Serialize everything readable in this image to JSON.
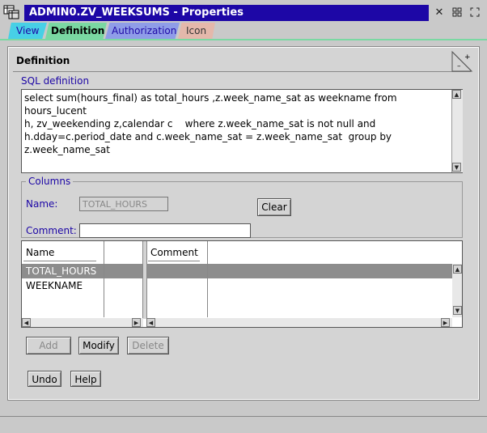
{
  "window": {
    "title": "ADMIN0.ZV_WEEKSUMS - Properties",
    "controls": {
      "close": "✕",
      "restore": "▫",
      "maximize": "⛶"
    }
  },
  "tabs": [
    {
      "label": "View"
    },
    {
      "label": "Definition"
    },
    {
      "label": "Authorization"
    },
    {
      "label": "Icon"
    }
  ],
  "panel": {
    "title": "Definition",
    "sql_label": "SQL definition",
    "sql_text": "select sum(hours_final) as total_hours ,z.week_name_sat as weekname from hours_lucent\nh, zv_weekending z,calendar c    where z.week_name_sat is not null and\nh.dday=c.period_date and c.week_name_sat = z.week_name_sat  group by\nz.week_name_sat"
  },
  "columns": {
    "group_label": "Columns",
    "name_label": "Name:",
    "name_value": "TOTAL_HOURS",
    "clear_label": "Clear",
    "comment_label": "Comment:",
    "comment_value": "",
    "headers": {
      "name": "Name",
      "comment": "Comment"
    },
    "rows": [
      {
        "name": "TOTAL_HOURS",
        "comment": ""
      },
      {
        "name": "WEEKNAME",
        "comment": ""
      }
    ]
  },
  "buttons": {
    "add": "Add",
    "modify": "Modify",
    "delete": "Delete",
    "undo": "Undo",
    "help": "Help"
  },
  "colors": {
    "title_bar": "#1d07a6",
    "selected_row": "#8d8d8d"
  }
}
